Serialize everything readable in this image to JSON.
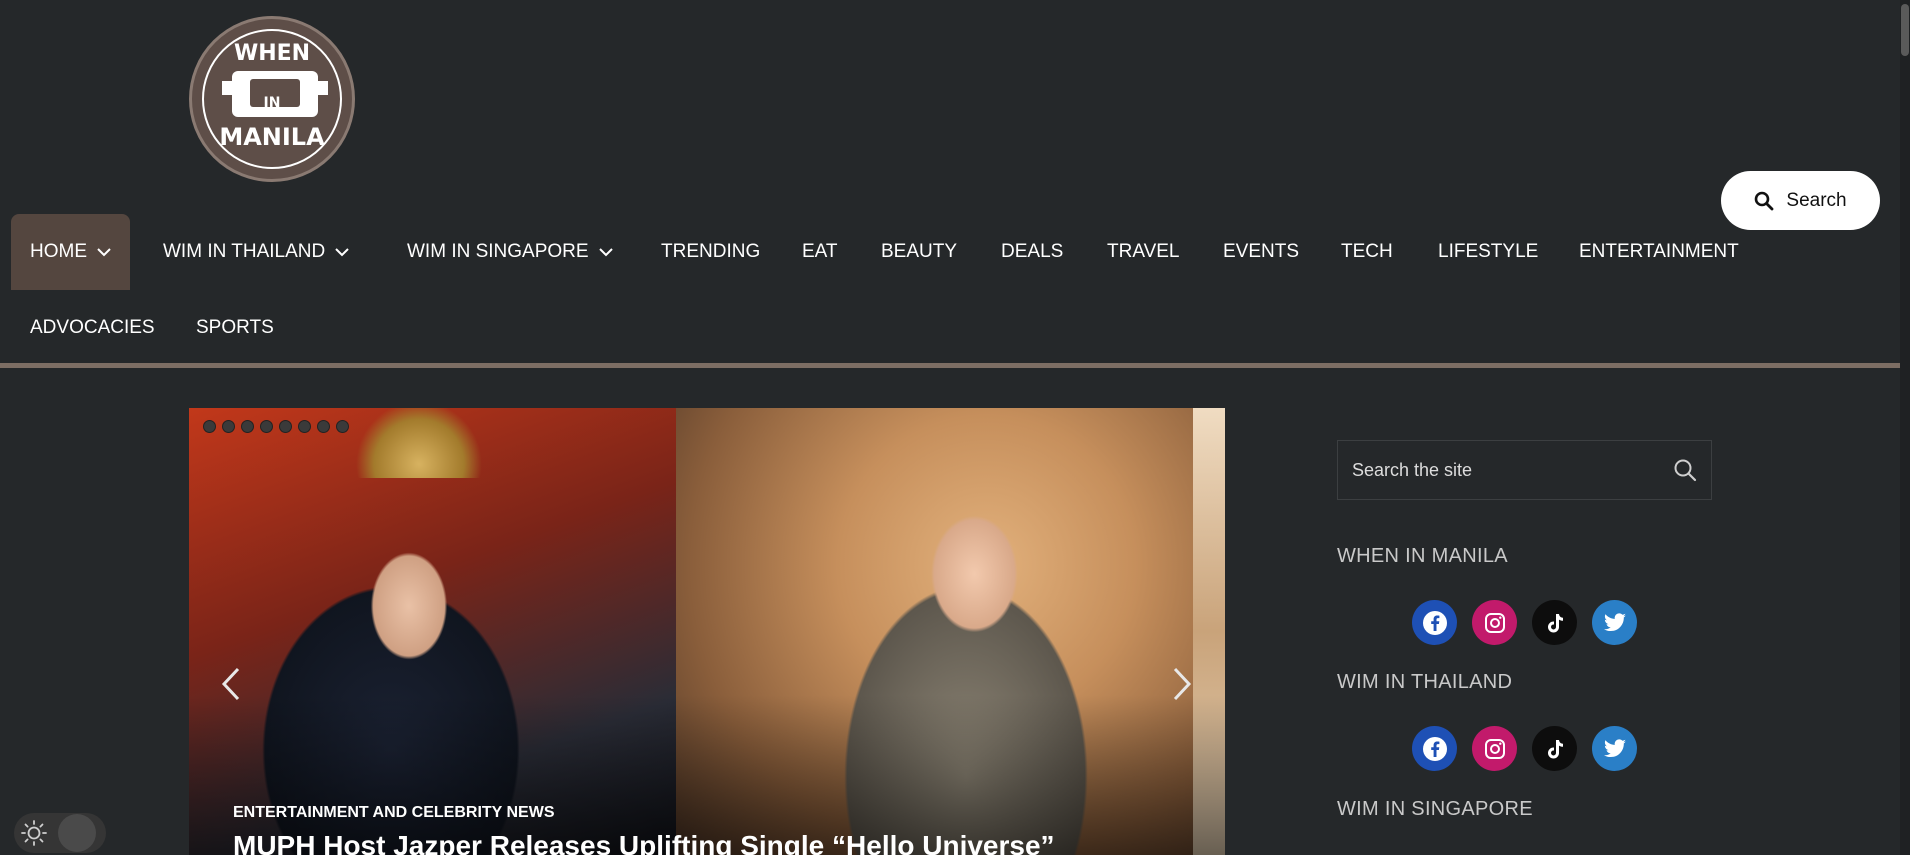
{
  "logo": {
    "line1": "WHEN",
    "line2": "IN",
    "line3": "MANILA"
  },
  "header": {
    "search_label": "Search"
  },
  "nav": {
    "items": [
      {
        "label": "HOME",
        "dropdown": true
      },
      {
        "label": "WIM IN THAILAND",
        "dropdown": true
      },
      {
        "label": "WIM IN SINGAPORE",
        "dropdown": true
      },
      {
        "label": "TRENDING"
      },
      {
        "label": "EAT"
      },
      {
        "label": "BEAUTY"
      },
      {
        "label": "DEALS"
      },
      {
        "label": "TRAVEL"
      },
      {
        "label": "EVENTS"
      },
      {
        "label": "TECH"
      },
      {
        "label": "LIFESTYLE"
      },
      {
        "label": "ENTERTAINMENT"
      },
      {
        "label": "ADVOCACIES"
      },
      {
        "label": "SPORTS"
      }
    ]
  },
  "slider": {
    "category": "ENTERTAINMENT AND CELEBRITY NEWS",
    "title": "MUPH Host Jazper Releases Uplifting Single “Hello Universe”",
    "dot_count": 8
  },
  "sidebar": {
    "search_placeholder": "Search the site",
    "sections": [
      {
        "heading": "WHEN IN MANILA"
      },
      {
        "heading": "WIM IN THAILAND"
      },
      {
        "heading": "WIM IN SINGAPORE"
      }
    ]
  },
  "colors": {
    "background": "#25282a",
    "active_nav": "#54463f",
    "facebook": "#1e50b5",
    "instagram": "#c21a6b",
    "tiktok": "#0d0d0d",
    "twitter": "#2a7fc7"
  }
}
